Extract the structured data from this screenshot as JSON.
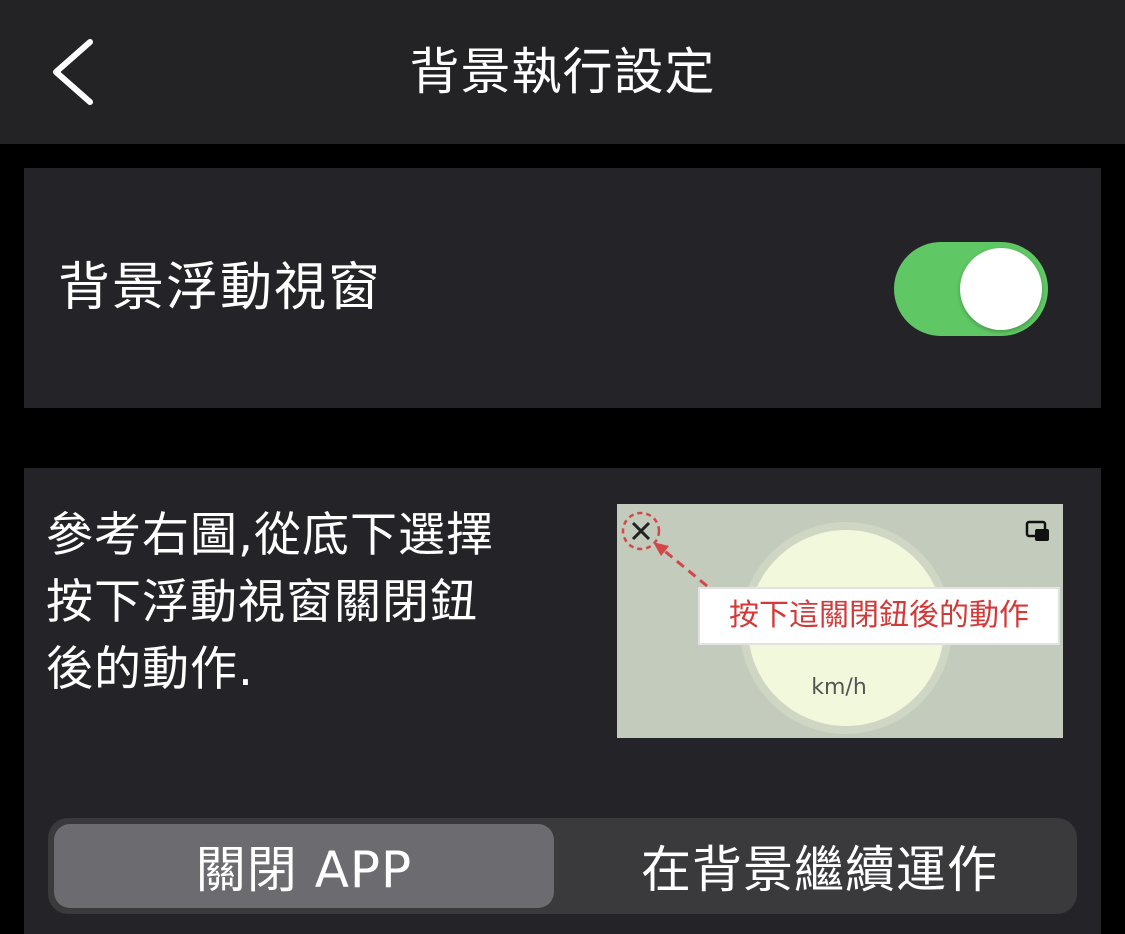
{
  "navbar": {
    "title": "背景執行設定",
    "back_icon": "chevron-left-icon"
  },
  "floating_window": {
    "label": "背景浮動視窗",
    "toggle_on": true,
    "toggle_color": "#5fc864"
  },
  "close_action": {
    "description_lines": [
      "參考右圖,從底下選擇",
      "按下浮動視窗關閉鈕",
      "後的動作."
    ],
    "preview": {
      "annotation": "按下這關閉鈕後的動作",
      "speed_unit": "km/h",
      "close_icon": "close-icon",
      "pip_icon": "picture-in-picture-icon"
    },
    "options": [
      "關閉 APP",
      "在背景繼續運作"
    ],
    "selected_index": 0
  }
}
